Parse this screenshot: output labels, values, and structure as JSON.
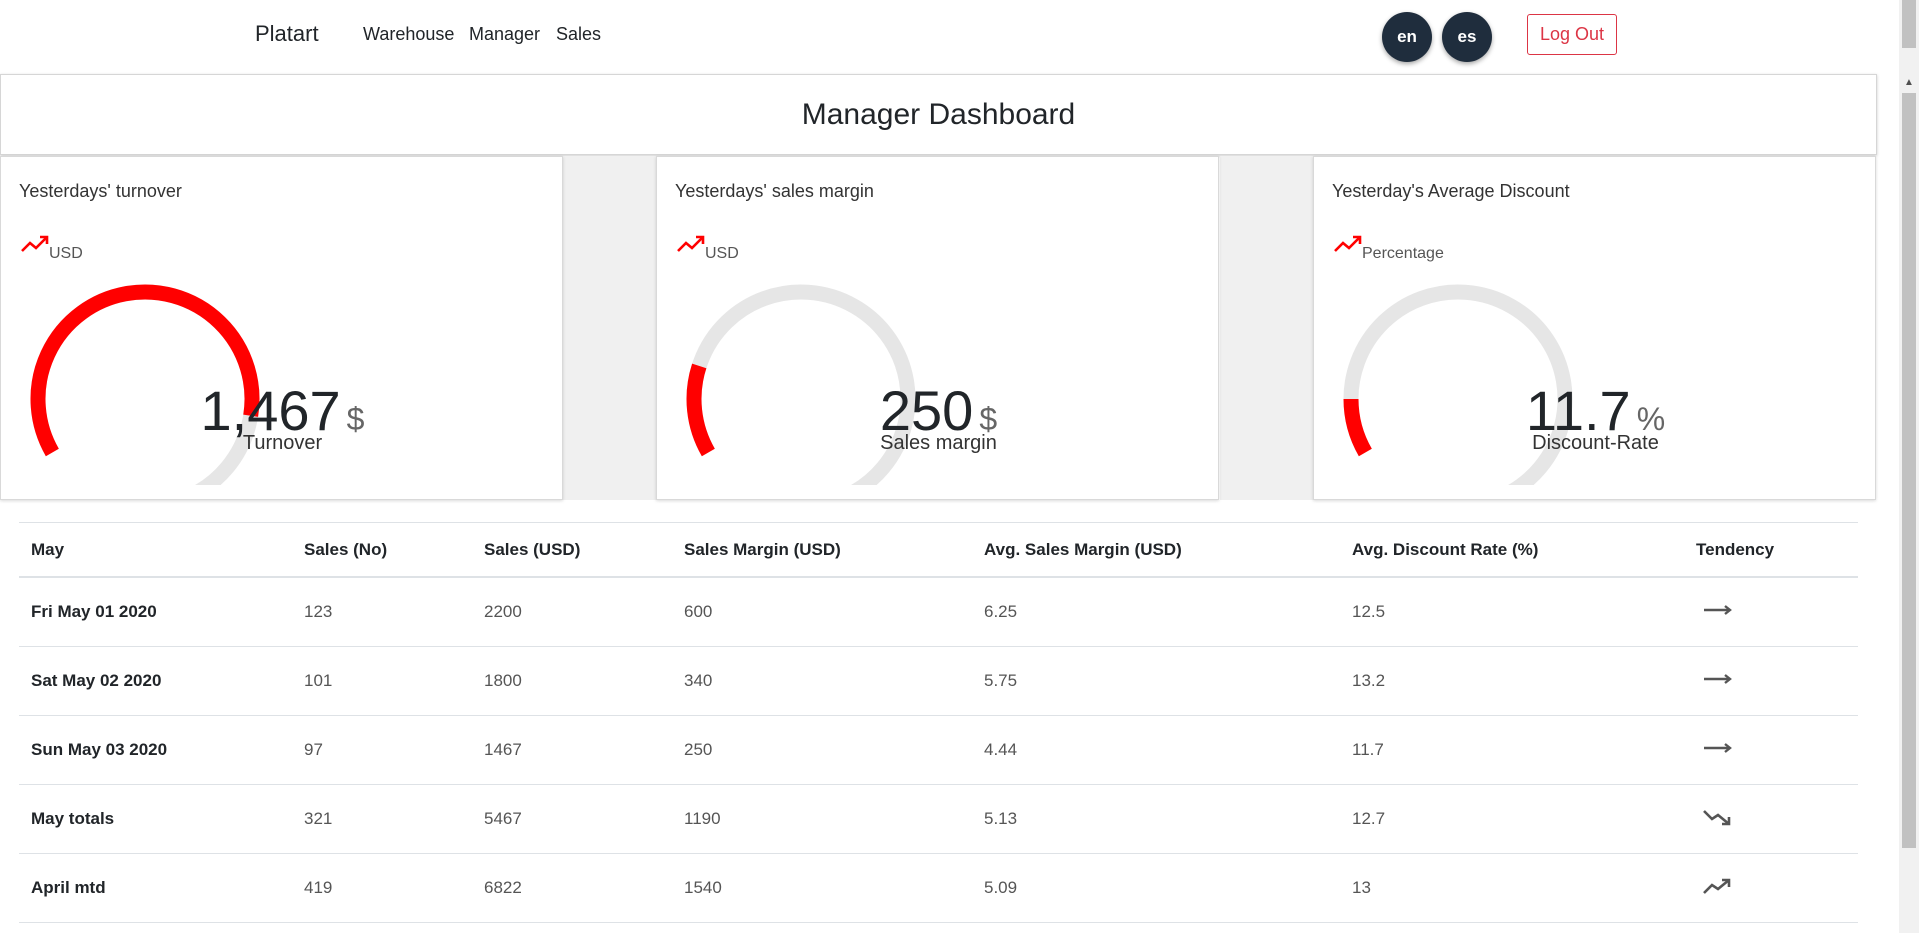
{
  "navbar": {
    "brand": "Platart",
    "links": [
      "Warehouse",
      "Manager",
      "Sales"
    ],
    "languages": [
      "en",
      "es"
    ],
    "logout": "Log Out"
  },
  "header": {
    "title": "Manager Dashboard"
  },
  "kpis": [
    {
      "title": "Yesterdays' turnover",
      "unit": "USD",
      "value": "1,467",
      "symbol": "$",
      "label": "Turnover",
      "gauge_fill": 0.73,
      "trend_icon": "trending-up-icon"
    },
    {
      "title": "Yesterdays' sales margin",
      "unit": "USD",
      "value": "250",
      "symbol": "$",
      "label": "Sales margin",
      "gauge_fill": 0.16,
      "trend_icon": "trending-up-icon"
    },
    {
      "title": "Yesterday's Average Discount",
      "unit": "Percentage",
      "value": "11.7",
      "symbol": "%",
      "label": "Discount-Rate",
      "gauge_fill": 0.1,
      "trend_icon": "trending-up-icon"
    }
  ],
  "colors": {
    "accent": "#ff0000",
    "gauge_track": "#e6e6e6",
    "button_dark": "#1f2d3d",
    "danger": "#dc3545"
  },
  "table": {
    "headers": [
      "May",
      "Sales (No)",
      "Sales (USD)",
      "Sales Margin (USD)",
      "Avg. Sales Margin (USD)",
      "Avg. Discount Rate (%)",
      "Tendency"
    ],
    "rows": [
      {
        "date": "Fri May 01 2020",
        "sales_no": "123",
        "sales_usd": "2200",
        "margin": "600",
        "avg_margin": "6.25",
        "discount": "12.5",
        "tendency": "flat"
      },
      {
        "date": "Sat May 02 2020",
        "sales_no": "101",
        "sales_usd": "1800",
        "margin": "340",
        "avg_margin": "5.75",
        "discount": "13.2",
        "tendency": "flat"
      },
      {
        "date": "Sun May 03 2020",
        "sales_no": "97",
        "sales_usd": "1467",
        "margin": "250",
        "avg_margin": "4.44",
        "discount": "11.7",
        "tendency": "flat"
      },
      {
        "date": "May totals",
        "sales_no": "321",
        "sales_usd": "5467",
        "margin": "1190",
        "avg_margin": "5.13",
        "discount": "12.7",
        "tendency": "down"
      },
      {
        "date": "April mtd",
        "sales_no": "419",
        "sales_usd": "6822",
        "margin": "1540",
        "avg_margin": "5.09",
        "discount": "13",
        "tendency": "up"
      }
    ]
  }
}
